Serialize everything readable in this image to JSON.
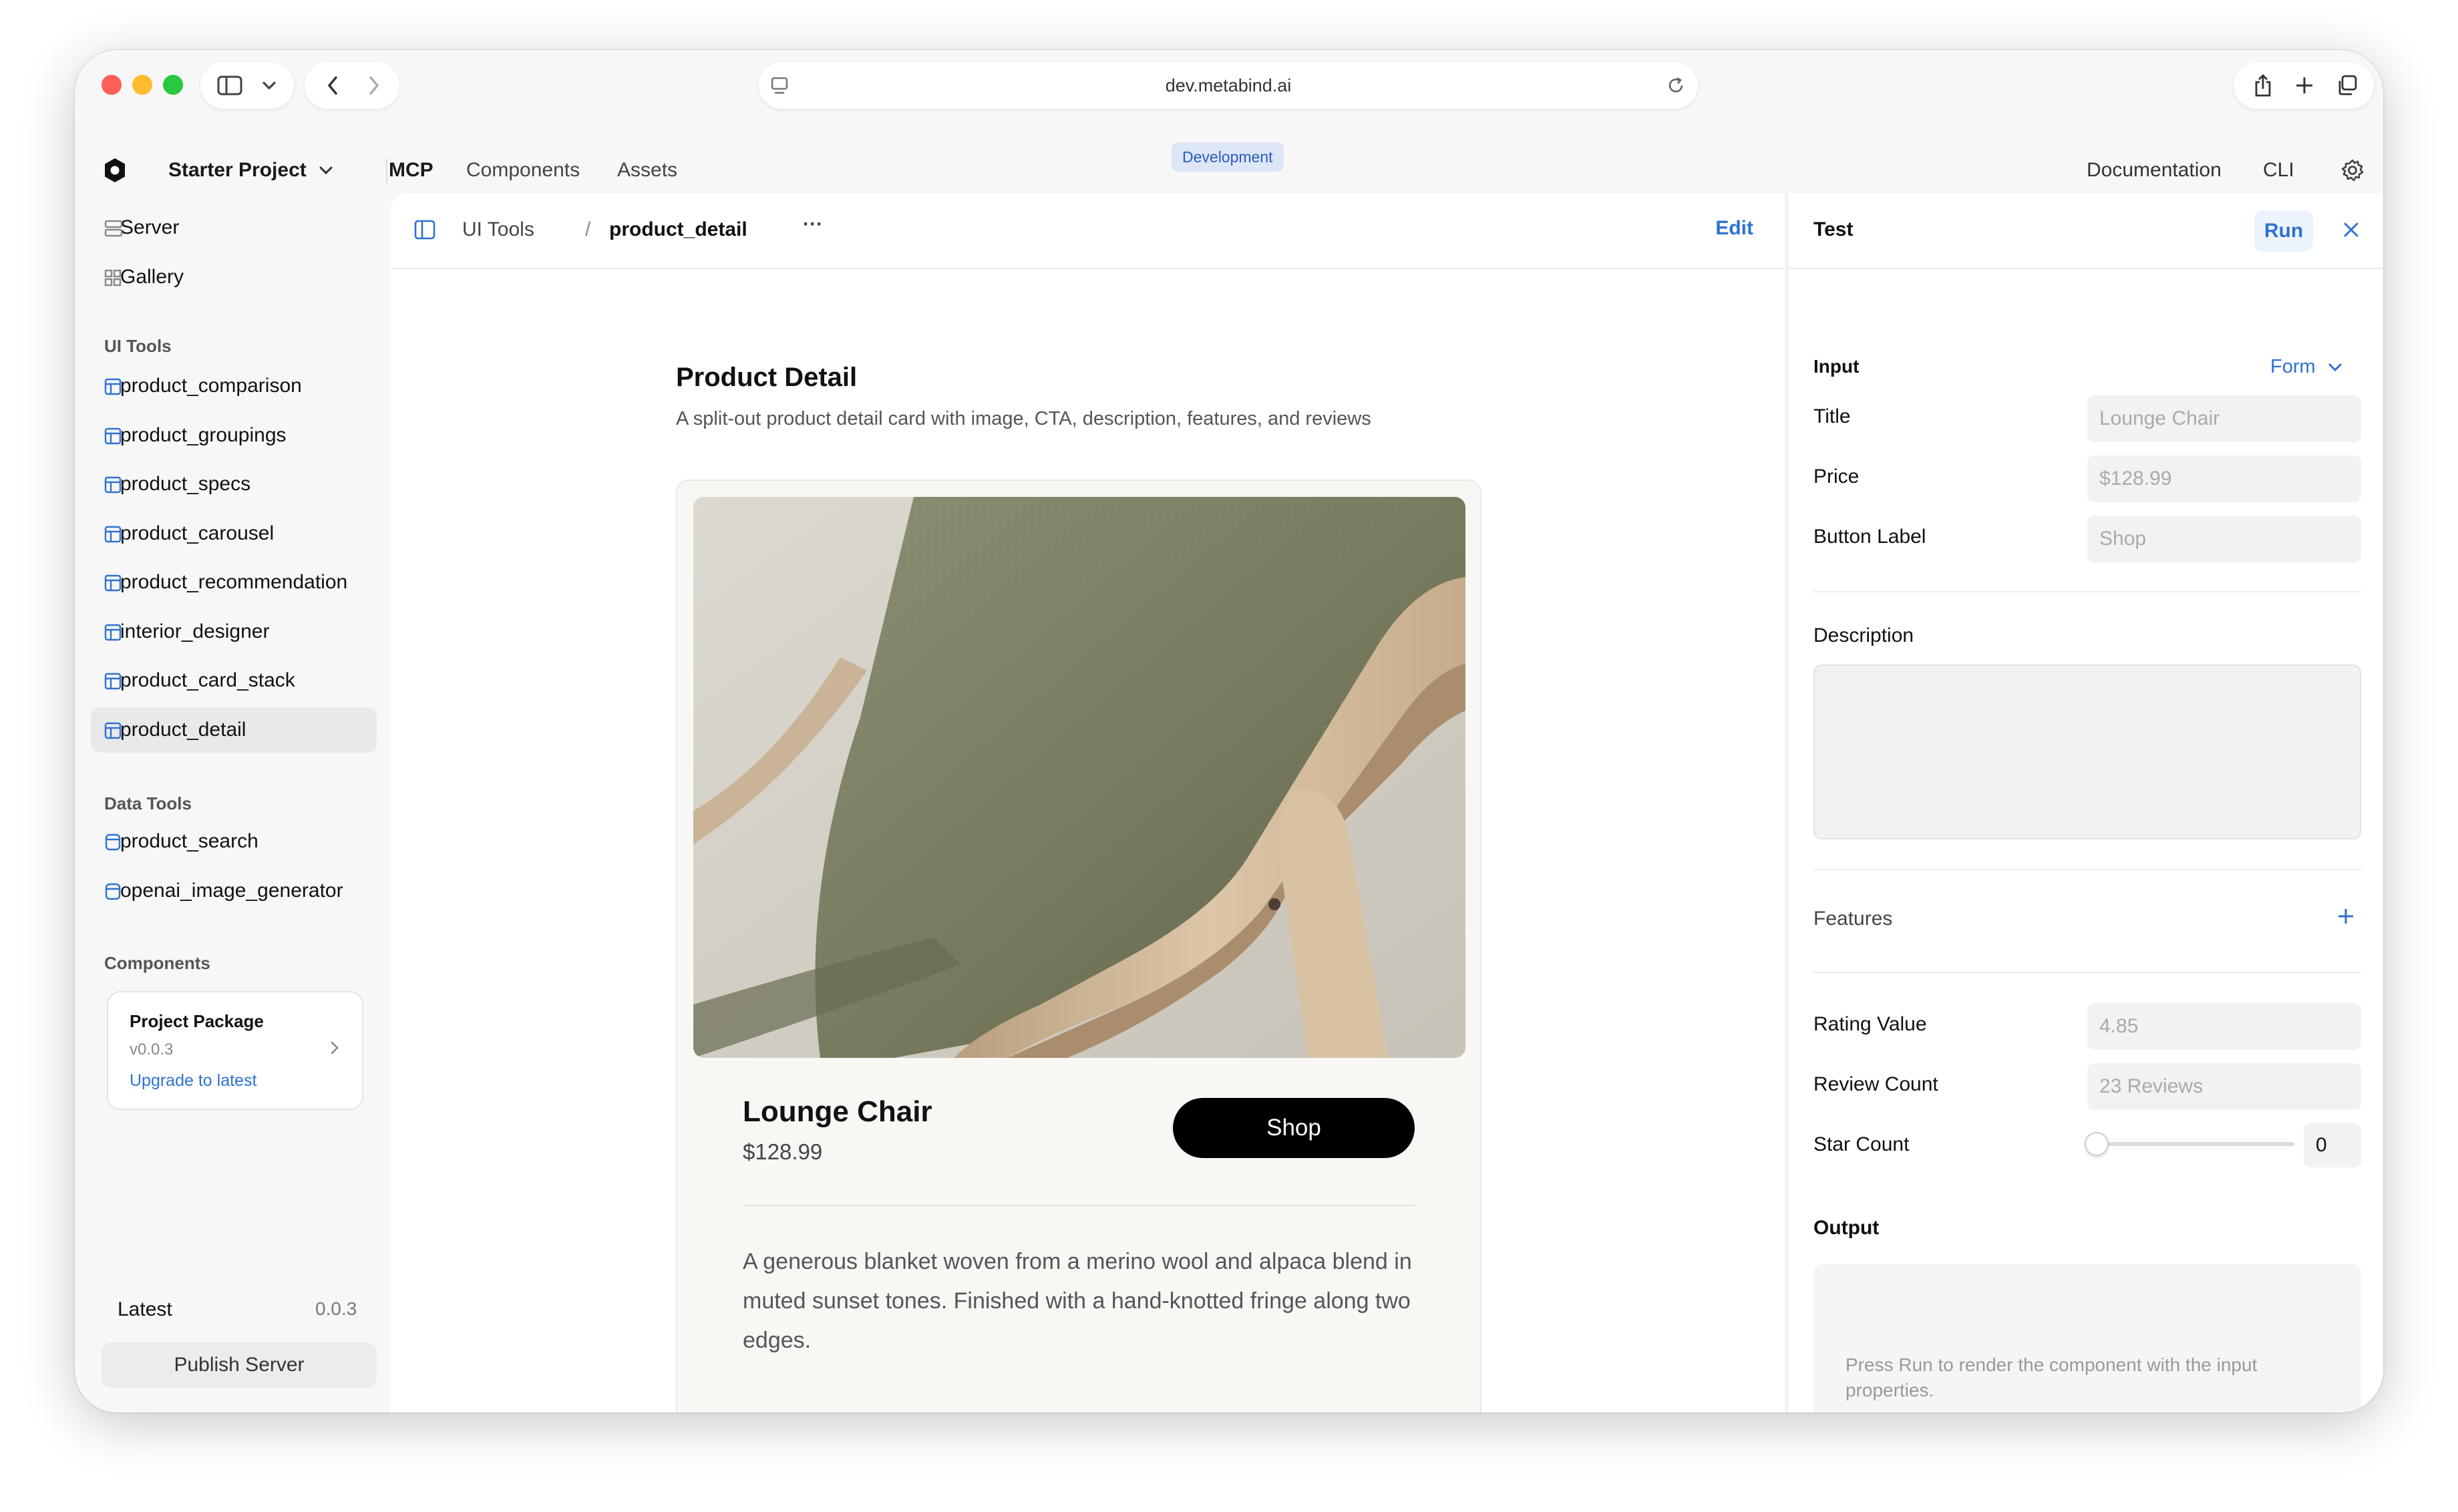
{
  "browser": {
    "url": "dev.metabind.ai",
    "icons": [
      "sidebar-toggle-icon",
      "chevron-down-icon",
      "back-icon",
      "forward-icon",
      "reader-icon",
      "reload-icon",
      "share-icon",
      "new-tab-icon",
      "tabs-overview-icon"
    ]
  },
  "header": {
    "project": "Starter Project",
    "nav": [
      "MCP",
      "Components",
      "Assets"
    ],
    "env_badge": "Development",
    "links": [
      "Documentation",
      "CLI"
    ]
  },
  "sidebar": {
    "top_items": [
      "Server",
      "Gallery"
    ],
    "ui_tools_heading": "UI Tools",
    "ui_tools": [
      "product_comparison",
      "product_groupings",
      "product_specs",
      "product_carousel",
      "product_recommendation",
      "interior_designer",
      "product_card_stack",
      "product_detail"
    ],
    "data_tools_heading": "Data Tools",
    "data_tools": [
      "product_search",
      "openai_image_generator"
    ],
    "components_heading": "Components",
    "package": {
      "name": "Project Package",
      "version": "v0.0.3",
      "upgrade": "Upgrade to latest"
    },
    "latest_label": "Latest",
    "latest_version": "0.0.3",
    "publish": "Publish Server"
  },
  "main": {
    "breadcrumb_parent": "UI Tools",
    "breadcrumb_sep": "/",
    "breadcrumb_current": "product_detail",
    "more": "···",
    "edit": "Edit",
    "title": "Product Detail",
    "subtitle": "A split-out product detail card with image, CTA, description, features, and reviews",
    "card": {
      "name": "Lounge Chair",
      "price": "$128.99",
      "button": "Shop",
      "description": "A generous blanket woven from a merino wool and alpaca blend in muted sunset tones. Finished with a hand-knotted fringe along two edges."
    }
  },
  "test_panel": {
    "title": "Test",
    "run": "Run",
    "input_heading": "Input",
    "mode": "Form",
    "fields": {
      "title_label": "Title",
      "title_placeholder": "Lounge Chair",
      "price_label": "Price",
      "price_placeholder": "$128.99",
      "button_label": "Button Label",
      "button_placeholder": "Shop",
      "description_label": "Description",
      "features_label": "Features",
      "rating_label": "Rating Value",
      "rating_placeholder": "4.85",
      "review_label": "Review Count",
      "review_placeholder": "23 Reviews",
      "star_label": "Star Count",
      "star_value": "0"
    },
    "output_heading": "Output",
    "output_hint": "Press Run to render the component with the input properties."
  },
  "colors": {
    "accent": "#2d72d2",
    "close": "#ff5f57",
    "minimize": "#febc2e",
    "zoom": "#28c840"
  }
}
